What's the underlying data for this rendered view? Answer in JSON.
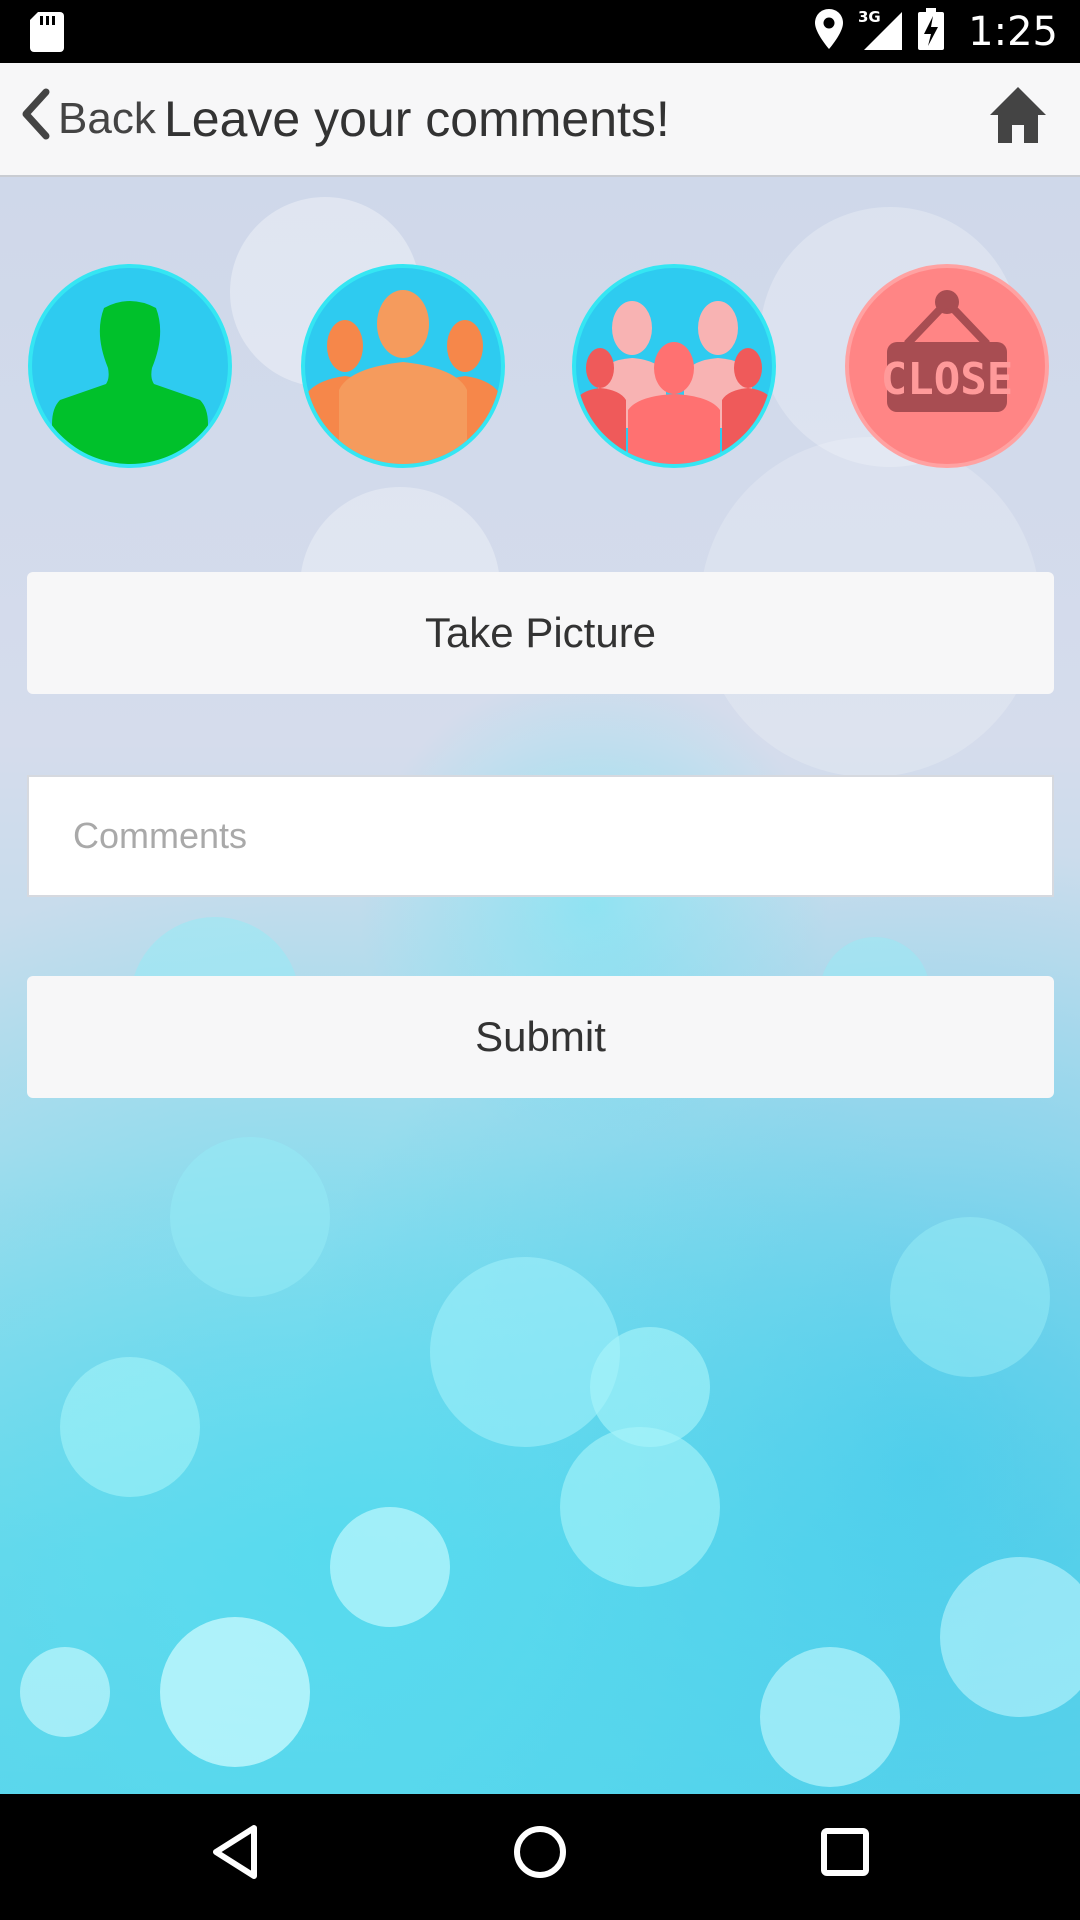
{
  "status_bar": {
    "time": "1:25",
    "network": "3G",
    "icons": [
      "sd-card-icon",
      "location-pin-icon",
      "signal-3g-icon",
      "battery-charging-icon"
    ]
  },
  "header": {
    "back_label": "Back",
    "title": "Leave your comments!",
    "home_icon": "home-icon"
  },
  "audience_buttons": [
    {
      "name": "single-person-icon",
      "color": "#00c12b"
    },
    {
      "name": "group-orange-icon",
      "color": "#f59b5d"
    },
    {
      "name": "group-pink-icon",
      "color": "#ff7171"
    },
    {
      "name": "close-sign-icon",
      "text": "CLOSE",
      "color": "#a84d52"
    }
  ],
  "actions": {
    "take_picture_label": "Take Picture",
    "comments_placeholder": "Comments",
    "submit_label": "Submit"
  },
  "nav_bar": {
    "icons": [
      "back-triangle-icon",
      "home-circle-icon",
      "recents-square-icon"
    ]
  },
  "colors": {
    "header_bg": "#f7f7f8",
    "circle_blue": "#2ecbf0",
    "circle_pink": "#ff8585"
  }
}
